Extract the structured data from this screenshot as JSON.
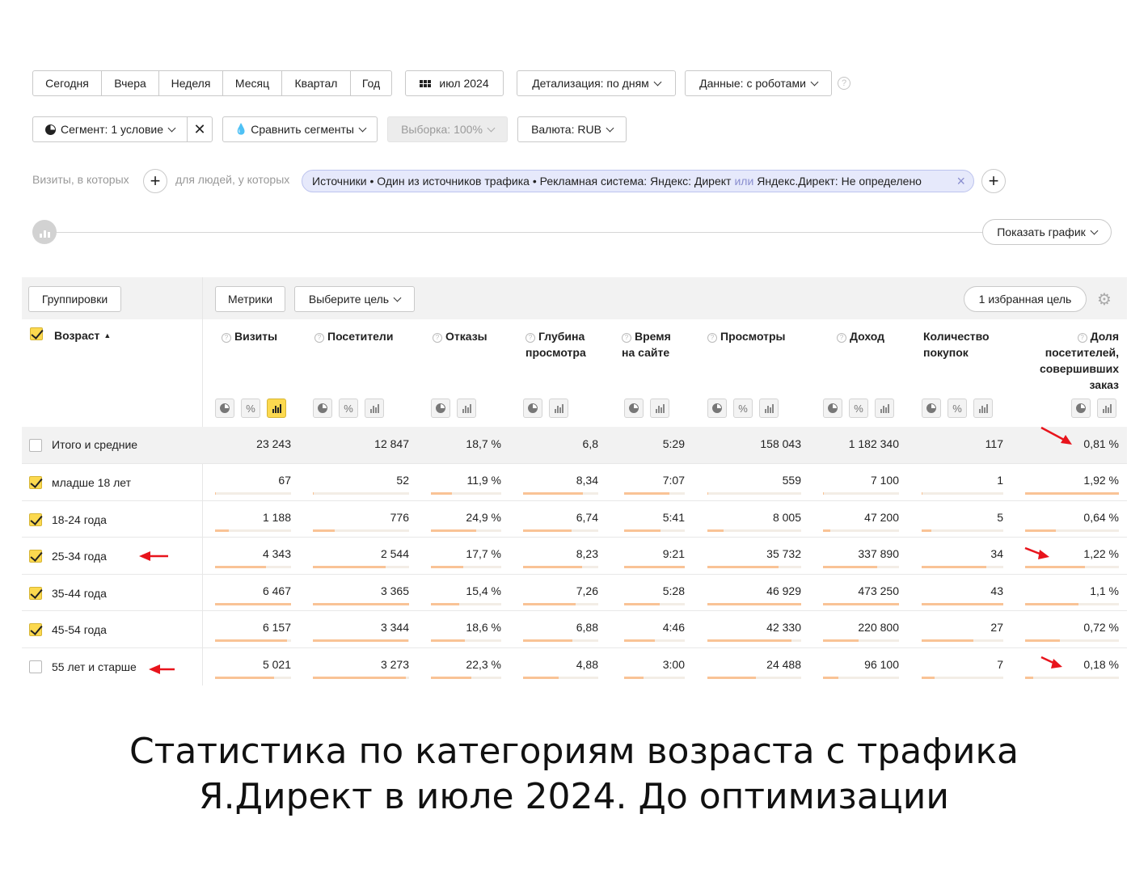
{
  "period_tabs": [
    "Сегодня",
    "Вчера",
    "Неделя",
    "Месяц",
    "Квартал",
    "Год"
  ],
  "date_button": "июл 2024",
  "detail_dropdown": "Детализация: по дням",
  "data_dropdown": "Данные: с роботами",
  "segment_button": "Сегмент: 1 условие",
  "compare_segments": "Сравнить сегменты",
  "sample_dropdown": "Выборка: 100%",
  "currency_dropdown": "Валюта: RUB",
  "visits_label": "Визиты, в которых",
  "people_label": "для людей, у которых",
  "filter": {
    "part1": "Источники • Один из источников трафика • Рекламная система: Яндекс: Директ",
    "or": "или",
    "part2": "Яндекс.Директ: Не определено"
  },
  "show_chart": "Показать график",
  "groupings_button": "Группировки",
  "metrics_button": "Метрики",
  "goal_dropdown": "Выберите цель",
  "favorite_goal": "1 избранная цель",
  "dimension_header": "Возраст",
  "columns": [
    {
      "l1": "Визиты",
      "l2": "",
      "l3": "",
      "l4": ""
    },
    {
      "l1": "Посетители",
      "l2": "",
      "l3": "",
      "l4": ""
    },
    {
      "l1": "Отказы",
      "l2": "",
      "l3": "",
      "l4": ""
    },
    {
      "l1": "Глубина",
      "l2": "просмотра",
      "l3": "",
      "l4": ""
    },
    {
      "l1": "Время",
      "l2": "на сайте",
      "l3": "",
      "l4": ""
    },
    {
      "l1": "Просмотры",
      "l2": "",
      "l3": "",
      "l4": ""
    },
    {
      "l1": "Доход",
      "l2": "",
      "l3": "",
      "l4": ""
    },
    {
      "l1": "Количество",
      "l2": "покупок",
      "l3": "",
      "l4": ""
    },
    {
      "l1": "Доля",
      "l2": "посетителей,",
      "l3": "совершивших",
      "l4": "заказ"
    }
  ],
  "total_row": {
    "label": "Итого и средние",
    "values": [
      "23 243",
      "12 847",
      "18,7 %",
      "6,8",
      "5:29",
      "158 043",
      "1 182 340",
      "117",
      "0,81 %"
    ]
  },
  "rows": [
    {
      "label": "младше 18 лет",
      "checked": true,
      "values": [
        "67",
        "52",
        "11,9 %",
        "8,34",
        "7:07",
        "559",
        "7 100",
        "1",
        "1,92 %"
      ],
      "shares": [
        0.01,
        0.01,
        0.3,
        0.8,
        0.75,
        0.01,
        0.01,
        0.01,
        1.0
      ]
    },
    {
      "label": "18-24 года",
      "checked": true,
      "values": [
        "1 188",
        "776",
        "24,9 %",
        "6,74",
        "5:41",
        "8 005",
        "47 200",
        "5",
        "0,64 %"
      ],
      "shares": [
        0.18,
        0.23,
        0.64,
        0.65,
        0.6,
        0.17,
        0.1,
        0.12,
        0.33
      ]
    },
    {
      "label": "25-34 года",
      "checked": true,
      "values": [
        "4 343",
        "2 544",
        "17,7 %",
        "8,23",
        "9:21",
        "35 732",
        "337 890",
        "34",
        "1,22 %"
      ],
      "shares": [
        0.67,
        0.76,
        0.46,
        0.79,
        1.0,
        0.76,
        0.71,
        0.79,
        0.64
      ]
    },
    {
      "label": "35-44 года",
      "checked": true,
      "values": [
        "6 467",
        "3 365",
        "15,4 %",
        "7,26",
        "5:28",
        "46 929",
        "473 250",
        "43",
        "1,1 %"
      ],
      "shares": [
        1.0,
        1.0,
        0.4,
        0.7,
        0.58,
        1.0,
        1.0,
        1.0,
        0.57
      ]
    },
    {
      "label": "45-54 года",
      "checked": true,
      "values": [
        "6 157",
        "3 344",
        "18,6 %",
        "6,88",
        "4:46",
        "42 330",
        "220 800",
        "27",
        "0,72 %"
      ],
      "shares": [
        0.95,
        0.99,
        0.48,
        0.66,
        0.51,
        0.9,
        0.47,
        0.63,
        0.37
      ]
    },
    {
      "label": "55 лет и старше",
      "checked": false,
      "values": [
        "5 021",
        "3 273",
        "22,3 %",
        "4,88",
        "3:00",
        "24 488",
        "96 100",
        "7",
        "0,18 %"
      ],
      "shares": [
        0.78,
        0.97,
        0.58,
        0.47,
        0.32,
        0.52,
        0.2,
        0.16,
        0.09
      ]
    }
  ],
  "caption_line1": "Статистика по категориям возраста с трафика",
  "caption_line2": "Я.Директ в июле 2024. До оптимизации",
  "colors": {
    "accent_yellow": "#fcd94f",
    "bar_fill": "#f9c396",
    "pill_bg": "#e6e9fb",
    "arrow_red": "#e8141c"
  }
}
